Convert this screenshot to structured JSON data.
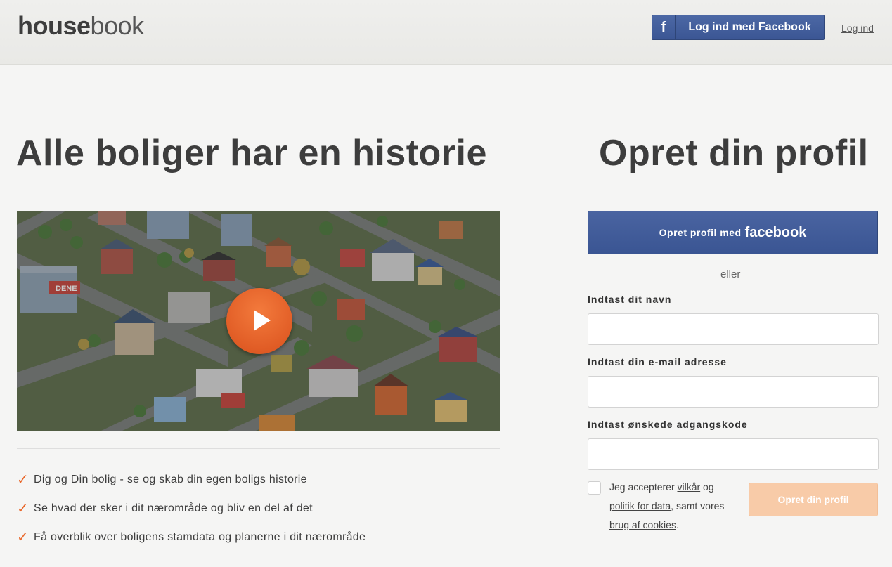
{
  "header": {
    "logo_bold": "house",
    "logo_light": "book",
    "fb_icon": "f",
    "fb_login_label": "Log ind med Facebook",
    "login_link": "Log ind"
  },
  "hero": {
    "title": "Alle boliger har en historie",
    "video_sign": "DENE",
    "features": [
      "Dig og Din bolig - se og skab din egen boligs historie",
      "Se hvad der sker i dit nærområde og bliv en del af det",
      "Få overblik over boligens stamdata og planerne i dit nærområde"
    ],
    "check_glyph": "✓"
  },
  "signup": {
    "title": "Opret din profil",
    "fb_button_prefix": "Opret profil med",
    "fb_button_brand": "facebook",
    "or_text": "eller",
    "name_label": "Indtast dit navn",
    "name_value": "",
    "email_label": "Indtast din e-mail adresse",
    "email_value": "",
    "password_label": "Indtast ønskede adgangskode",
    "password_value": "",
    "terms_pre": "Jeg accepterer ",
    "terms_link": "vilkår",
    "terms_mid": " og ",
    "privacy_link": "politik for data",
    "terms_mid2": ", samt vores ",
    "cookies_link": "brug af cookies",
    "terms_end": ".",
    "submit_label": "Opret din profil"
  },
  "colors": {
    "facebook_blue": "#3b5694",
    "accent_orange": "#e9672a",
    "submit_disabled": "#f8cba8"
  },
  "icons": {
    "play": "play-icon",
    "check": "checkmark-icon",
    "facebook": "facebook-f-icon"
  }
}
